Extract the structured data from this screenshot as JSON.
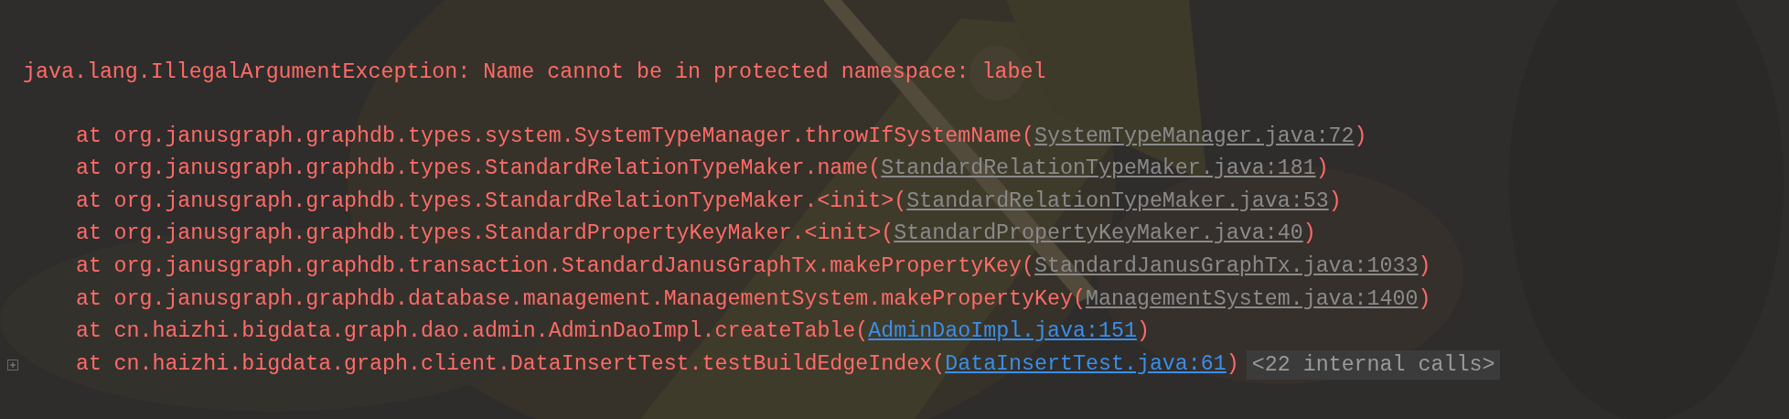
{
  "exception": "java.lang.IllegalArgumentException: Name cannot be in protected namespace: label",
  "frames": [
    {
      "prefix": "at",
      "method": "org.janusgraph.graphdb.types.system.SystemTypeManager.throwIfSystemName(",
      "location": "SystemTypeManager.java:72",
      "close": ")",
      "kind": "library"
    },
    {
      "prefix": "at",
      "method": "org.janusgraph.graphdb.types.StandardRelationTypeMaker.name(",
      "location": "StandardRelationTypeMaker.java:181",
      "close": ")",
      "kind": "library"
    },
    {
      "prefix": "at",
      "method": "org.janusgraph.graphdb.types.StandardRelationTypeMaker.<init>(",
      "location": "StandardRelationTypeMaker.java:53",
      "close": ")",
      "kind": "library"
    },
    {
      "prefix": "at",
      "method": "org.janusgraph.graphdb.types.StandardPropertyKeyMaker.<init>(",
      "location": "StandardPropertyKeyMaker.java:40",
      "close": ")",
      "kind": "library"
    },
    {
      "prefix": "at",
      "method": "org.janusgraph.graphdb.transaction.StandardJanusGraphTx.makePropertyKey(",
      "location": "StandardJanusGraphTx.java:1033",
      "close": ")",
      "kind": "library"
    },
    {
      "prefix": "at",
      "method": "org.janusgraph.graphdb.database.management.ManagementSystem.makePropertyKey(",
      "location": "ManagementSystem.java:1400",
      "close": ")",
      "kind": "library"
    },
    {
      "prefix": "at",
      "method": "cn.haizhi.bigdata.graph.dao.admin.AdminDaoImpl.createTable(",
      "location": "AdminDaoImpl.java:151",
      "close": ")",
      "kind": "project"
    },
    {
      "prefix": "at",
      "method": "cn.haizhi.bigdata.graph.client.DataInsertTest.testBuildEdgeIndex(",
      "location": "DataInsertTest.java:61",
      "close": ")",
      "kind": "project",
      "folded": "<22 internal calls>"
    }
  ]
}
